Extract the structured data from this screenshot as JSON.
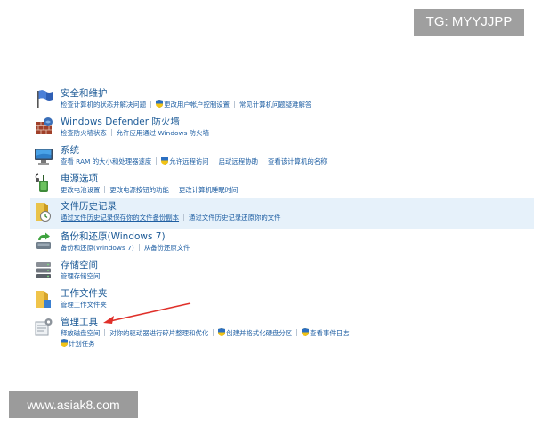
{
  "watermarks": {
    "top": "TG: MYYJJPP",
    "bottom": "www.asiak8.com"
  },
  "categories": [
    {
      "title": "安全和维护",
      "links": [
        "检查计算机的状态并解决问题",
        "更改用户帐户控制设置",
        "常见计算机问题疑难解答"
      ],
      "icon": "flag-icon"
    },
    {
      "title": "Windows Defender 防火墙",
      "links": [
        "检查防火墙状态",
        "允许应用通过 Windows 防火墙"
      ],
      "icon": "firewall-icon"
    },
    {
      "title": "系统",
      "links": [
        "查看 RAM 的大小和处理器速度",
        "允许远程访问",
        "启动远程协助",
        "查看该计算机的名称"
      ],
      "icon": "computer-icon"
    },
    {
      "title": "电源选项",
      "links": [
        "更改电池设置",
        "更改电源按钮的功能",
        "更改计算机睡眠时间"
      ],
      "icon": "power-icon"
    },
    {
      "title": "文件历史记录",
      "links": [
        "通过文件历史记录保存你的文件备份副本",
        "通过文件历史记录还原你的文件"
      ],
      "icon": "file-history-icon"
    },
    {
      "title": "备份和还原(Windows 7)",
      "links": [
        "备份和还原(Windows 7)",
        "从备份还原文件"
      ],
      "icon": "backup-icon"
    },
    {
      "title": "存储空间",
      "links": [
        "管理存储空间"
      ],
      "icon": "storage-icon"
    },
    {
      "title": "工作文件夹",
      "links": [
        "管理工作文件夹"
      ],
      "icon": "folder-icon"
    },
    {
      "title": "管理工具",
      "links": [
        "释放磁盘空间",
        "对你的驱动器进行碎片整理和优化",
        "创建并格式化硬盘分区",
        "查看事件日志",
        "计划任务"
      ],
      "icon": "admin-tools-icon"
    }
  ],
  "colors": {
    "link": "#1f5fa3",
    "title": "#1c5a96",
    "highlight": "#e6f1fa",
    "arrow": "#e0302a"
  }
}
